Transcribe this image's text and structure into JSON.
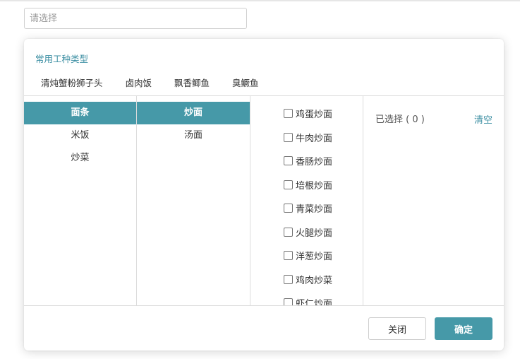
{
  "search": {
    "placeholder": "请选择",
    "value": ""
  },
  "panel": {
    "title": "常用工种类型",
    "quick_items": [
      "清炖蟹粉狮子头",
      "卤肉饭",
      "飘香鲫鱼",
      "臭鳜鱼"
    ],
    "col1_items": [
      "面条",
      "米饭",
      "炒菜"
    ],
    "col1_active_index": 0,
    "col2_items": [
      "炒面",
      "汤面"
    ],
    "col2_active_index": 0,
    "col3_items": [
      "鸡蛋炒面",
      "牛肉炒面",
      "香肠炒面",
      "培根炒面",
      "青菜炒面",
      "火腿炒面",
      "洋葱炒面",
      "鸡肉炒菜",
      "虾仁炒面"
    ],
    "selected_label": "已选择 ( 0 )",
    "clear_label": "清空",
    "close_label": "关闭",
    "ok_label": "确定"
  },
  "colors": {
    "accent": "#4699a8",
    "link": "#3d8fa3"
  }
}
